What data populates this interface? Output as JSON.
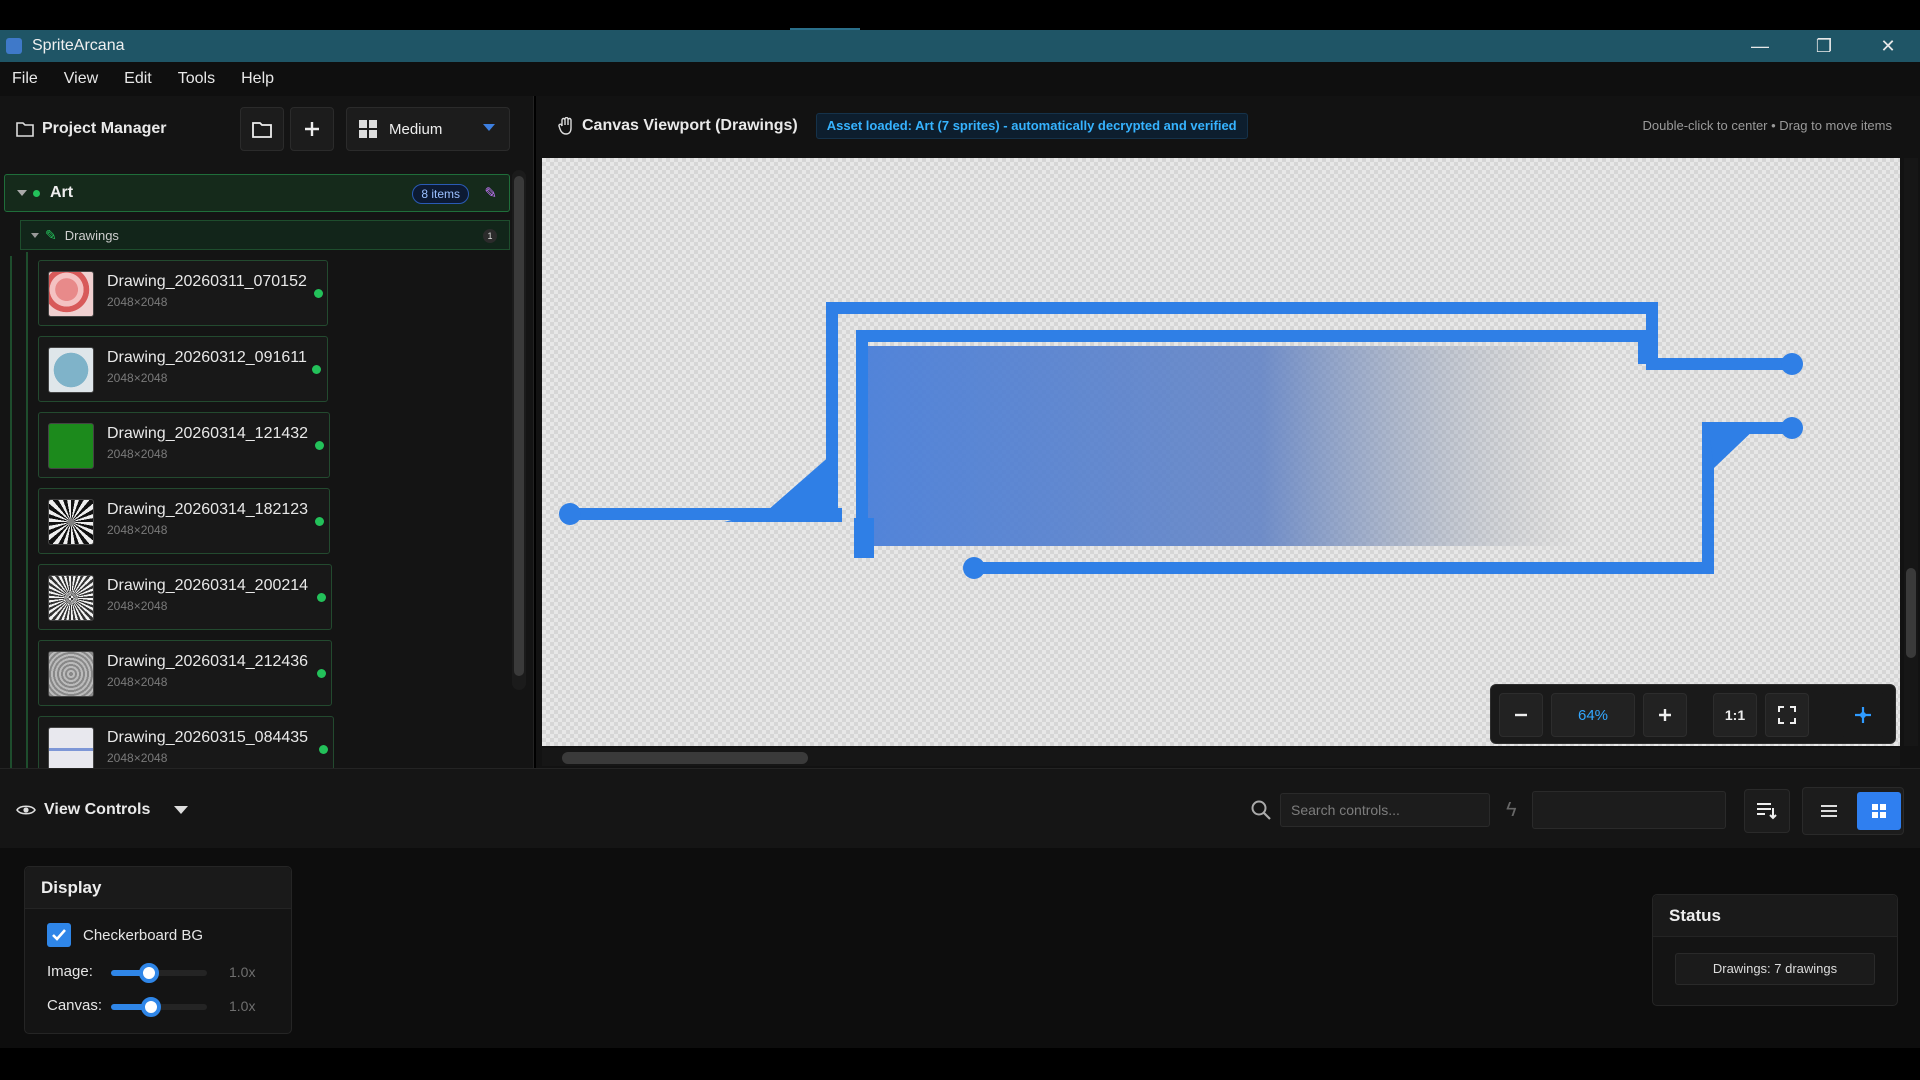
{
  "app": {
    "title": "SpriteArcana",
    "window_controls": {
      "minimize": "—",
      "maximize": "❐",
      "close": "✕"
    }
  },
  "menu": [
    "File",
    "View",
    "Edit",
    "Tools",
    "Help"
  ],
  "project_manager": {
    "title": "Project Manager",
    "size_select": "Medium",
    "group": {
      "name": "Art",
      "badge": "8 items"
    },
    "folder": {
      "name": "Drawings",
      "count": "1"
    },
    "items": [
      {
        "name": "Drawing_20260311_070152",
        "size": "2048×2048",
        "thumb": "red-pattern"
      },
      {
        "name": "Drawing_20260312_091611",
        "size": "2048×2048",
        "thumb": "blue-circle"
      },
      {
        "name": "Drawing_20260314_121432",
        "size": "2048×2048",
        "thumb": "green-square"
      },
      {
        "name": "Drawing_20260314_182123",
        "size": "2048×2048",
        "thumb": "black-rays"
      },
      {
        "name": "Drawing_20260314_200214",
        "size": "2048×2048",
        "thumb": "grey-rays"
      },
      {
        "name": "Drawing_20260314_212436",
        "size": "2048×2048",
        "thumb": "grey-rings"
      },
      {
        "name": "Drawing_20260315_084435",
        "size": "2048×2048",
        "thumb": "light-sketch"
      }
    ]
  },
  "canvas": {
    "title": "Canvas Viewport (Drawings)",
    "status_message": "Asset loaded: Art (7 sprites) - automatically decrypted and verified",
    "hint": "Double-click to center • Drag to move items",
    "zoom": {
      "value": "64%",
      "one_to_one": "1:1"
    },
    "colors": {
      "stroke": "#2f7fe6",
      "fill_start": "#4a7fd9"
    }
  },
  "view_controls": {
    "title": "View Controls",
    "search_placeholder": "Search controls...",
    "filter_value": ""
  },
  "display": {
    "title": "Display",
    "checkerboard_label": "Checkerboard BG",
    "checkerboard_checked": true,
    "image_label": "Image:",
    "image_value": "1.0x",
    "canvas_label": "Canvas:",
    "canvas_value": "1.0x"
  },
  "status": {
    "title": "Status",
    "value": "Drawings: 7 drawings"
  }
}
